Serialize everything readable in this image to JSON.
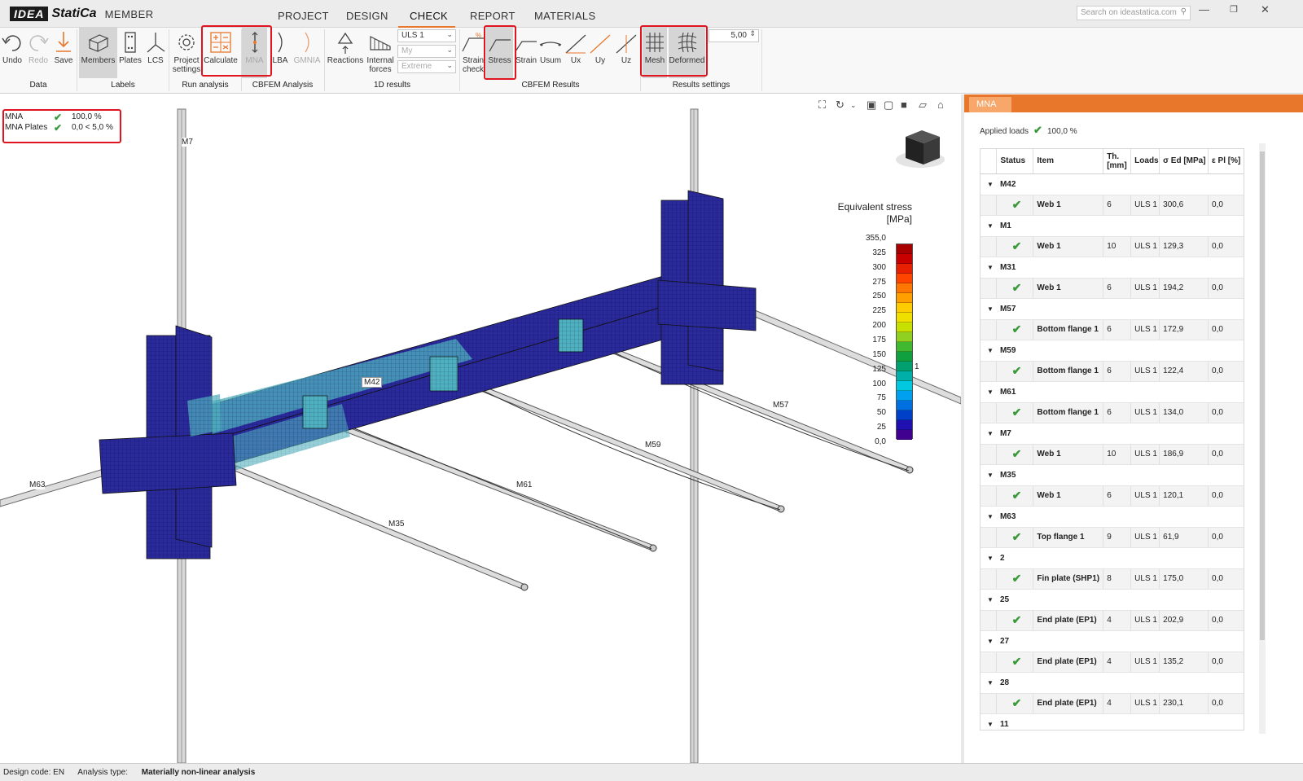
{
  "app": {
    "logo_badge": "IDEA",
    "brand": "StatiCa",
    "product": "MEMBER"
  },
  "menu": {
    "tabs": [
      "PROJECT",
      "DESIGN",
      "CHECK",
      "REPORT",
      "MATERIALS"
    ],
    "active": "CHECK"
  },
  "search": {
    "placeholder": "Search on ideastatica.com"
  },
  "ribbon": {
    "undo": "Undo",
    "redo": "Redo",
    "save": "Save",
    "members": "Members",
    "plates": "Plates",
    "lcs": "LCS",
    "project_settings_1": "Project",
    "project_settings_2": "settings",
    "calculate": "Calculate",
    "mna": "MNA",
    "lba": "LBA",
    "gmnia": "GMNIA",
    "reactions": "Reactions",
    "internal_forces_1": "Internal",
    "internal_forces_2": "forces",
    "load_case": "ULS 1",
    "component": "My",
    "extreme": "Extreme",
    "strain_check_1": "Strain",
    "strain_check_2": "check",
    "stress": "Stress",
    "strain": "Strain",
    "usum": "Usum",
    "ux": "Ux",
    "uy": "Uy",
    "uz": "Uz",
    "mesh": "Mesh",
    "deformed": "Deformed",
    "scale_value": "5,00",
    "groups": {
      "data": "Data",
      "labels": "Labels",
      "run_analysis": "Run analysis",
      "cbfem_analysis": "CBFEM Analysis",
      "results_1d": "1D results",
      "cbfem_results": "CBFEM Results",
      "results_settings": "Results settings"
    }
  },
  "summary": [
    {
      "label": "MNA",
      "value": "100,0 %"
    },
    {
      "label": "MNA Plates",
      "value": "0,0 < 5,0 %"
    }
  ],
  "legend": {
    "title": "Equivalent stress",
    "unit": "[MPa]",
    "ticks": [
      "355,0",
      "325",
      "300",
      "275",
      "250",
      "225",
      "200",
      "175",
      "150",
      "125",
      "100",
      "75",
      "50",
      "25",
      "0,0"
    ],
    "marker": "1",
    "colors": [
      "#a80000",
      "#c80000",
      "#e62000",
      "#ff4400",
      "#ff7700",
      "#ffa000",
      "#ffcc00",
      "#f0e000",
      "#c8e000",
      "#90d020",
      "#40b830",
      "#10a040",
      "#00a070",
      "#00b0a8",
      "#00c8e0",
      "#00a0f0",
      "#0070e0",
      "#0040c8",
      "#2010b0",
      "#400090"
    ]
  },
  "member_labels": [
    "M7",
    "M42",
    "M57",
    "M59",
    "M61",
    "M35",
    "M63"
  ],
  "panel": {
    "tab": "MNA",
    "applied_label": "Applied loads",
    "applied_value": "100,0 %",
    "columns": {
      "status": "Status",
      "item": "Item",
      "th_1": "Th.",
      "th_2": "[mm]",
      "loads": "Loads",
      "sigma": "σ Ed [MPa]",
      "eps": "ε Pl [%]"
    },
    "groups": [
      {
        "name": "M42",
        "item": "Web 1",
        "th": "6",
        "loads": "ULS 1",
        "sigma": "300,6",
        "eps": "0,0"
      },
      {
        "name": "M1",
        "item": "Web 1",
        "th": "10",
        "loads": "ULS 1",
        "sigma": "129,3",
        "eps": "0,0"
      },
      {
        "name": "M31",
        "item": "Web 1",
        "th": "6",
        "loads": "ULS 1",
        "sigma": "194,2",
        "eps": "0,0"
      },
      {
        "name": "M57",
        "item": "Bottom flange 1",
        "th": "6",
        "loads": "ULS 1",
        "sigma": "172,9",
        "eps": "0,0"
      },
      {
        "name": "M59",
        "item": "Bottom flange 1",
        "th": "6",
        "loads": "ULS 1",
        "sigma": "122,4",
        "eps": "0,0"
      },
      {
        "name": "M61",
        "item": "Bottom flange 1",
        "th": "6",
        "loads": "ULS 1",
        "sigma": "134,0",
        "eps": "0,0"
      },
      {
        "name": "M7",
        "item": "Web 1",
        "th": "10",
        "loads": "ULS 1",
        "sigma": "186,9",
        "eps": "0,0"
      },
      {
        "name": "M35",
        "item": "Web 1",
        "th": "6",
        "loads": "ULS 1",
        "sigma": "120,1",
        "eps": "0,0"
      },
      {
        "name": "M63",
        "item": "Top flange 1",
        "th": "9",
        "loads": "ULS 1",
        "sigma": "61,9",
        "eps": "0,0"
      },
      {
        "name": "2",
        "item": "Fin plate (SHP1)",
        "th": "8",
        "loads": "ULS 1",
        "sigma": "175,0",
        "eps": "0,0"
      },
      {
        "name": "25",
        "item": "End plate (EP1)",
        "th": "4",
        "loads": "ULS 1",
        "sigma": "202,9",
        "eps": "0,0"
      },
      {
        "name": "27",
        "item": "End plate (EP1)",
        "th": "4",
        "loads": "ULS 1",
        "sigma": "135,2",
        "eps": "0,0"
      },
      {
        "name": "28",
        "item": "End plate (EP1)",
        "th": "4",
        "loads": "ULS 1",
        "sigma": "230,1",
        "eps": "0,0"
      },
      {
        "name": "11"
      }
    ]
  },
  "status": {
    "design_code": "Design code: EN",
    "analysis_label": "Analysis type:",
    "analysis_value": "Materially non-linear analysis"
  },
  "colors": {
    "accent": "#e8762b",
    "highlight": "#e0141e",
    "ok": "#3a9a3a",
    "mesh_blue": "#2a2a9a"
  },
  "icons": [
    "undo-icon",
    "redo-icon",
    "save-icon",
    "members-icon",
    "plates-icon",
    "lcs-icon",
    "settings-icon",
    "calculate-icon",
    "mna-icon",
    "lba-icon",
    "gmnia-icon",
    "reactions-icon",
    "internal-forces-icon",
    "stress-icon",
    "mesh-icon",
    "deformed-icon",
    "search-icon",
    "checkmark-icon",
    "navigation-cube-icon"
  ]
}
